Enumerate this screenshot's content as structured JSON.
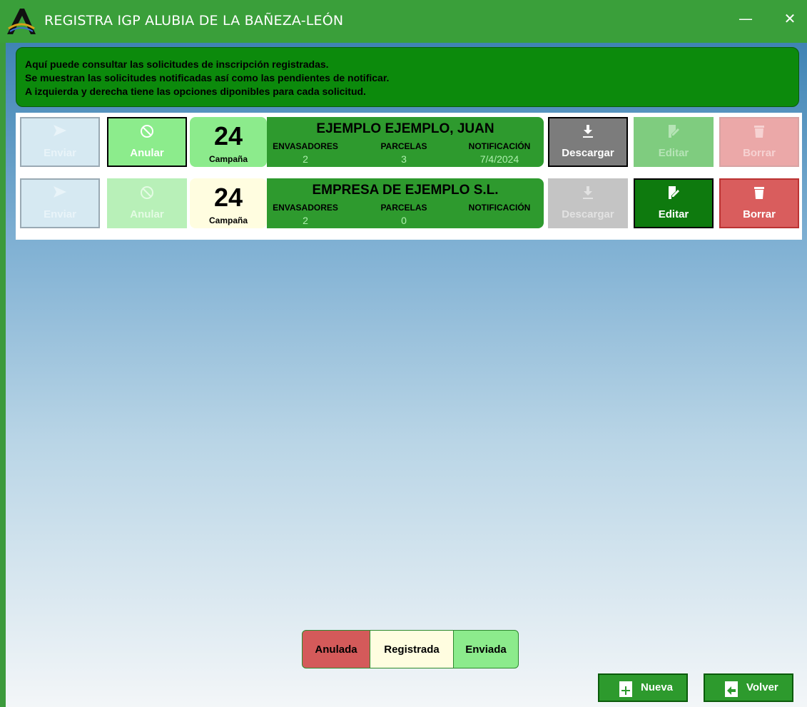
{
  "window": {
    "title": "REGISTRA IGP ALUBIA DE LA BAÑEZA-LEÓN",
    "minimize_glyph": "—",
    "close_glyph": "✕"
  },
  "info": {
    "line1": "Aquí puede consultar las solicitudes de inscripción registradas.",
    "line2": "Se muestran las solicitudes notificadas así como las pendientes de notificar.",
    "line3": "A izquierda y derecha tiene las opciones diponibles para cada solicitud."
  },
  "rows": [
    {
      "enviar": "Enviar",
      "enviar_enabled": false,
      "anular": "Anular",
      "anular_enabled": true,
      "campaign": "24",
      "campaign_label": "Campaña",
      "status": "Enviada",
      "name": "EJEMPLO EJEMPLO, JUAN",
      "envasadores_label": "ENVASADORES",
      "envasadores": "2",
      "parcelas_label": "PARCELAS",
      "parcelas": "3",
      "notificacion_label": "NOTIFICACIÓN",
      "notificacion": "7/4/2024",
      "descargar": "Descargar",
      "descargar_enabled": true,
      "editar": "Editar",
      "editar_enabled": false,
      "borrar": "Borrar",
      "borrar_enabled": false
    },
    {
      "enviar": "Enviar",
      "enviar_enabled": false,
      "anular": "Anular",
      "anular_enabled": false,
      "campaign": "24",
      "campaign_label": "Campaña",
      "status": "Registrada",
      "name": "EMPRESA DE EJEMPLO S.L.",
      "envasadores_label": "ENVASADORES",
      "envasadores": "2",
      "parcelas_label": "PARCELAS",
      "parcelas": "0",
      "notificacion_label": "NOTIFICACIÓN",
      "notificacion": "",
      "descargar": "Descargar",
      "descargar_enabled": false,
      "editar": "Editar",
      "editar_enabled": true,
      "borrar": "Borrar",
      "borrar_enabled": true
    }
  ],
  "legend": {
    "anulada": "Anulada",
    "registrada": "Registrada",
    "enviada": "Enviada"
  },
  "buttons": {
    "nueva": "Nueva",
    "volver": "Volver"
  },
  "colors": {
    "anulada": "#d45a5a",
    "registrada": "#fffde0",
    "enviada": "#8ceb8c",
    "brand_green": "#3a9f3a"
  }
}
